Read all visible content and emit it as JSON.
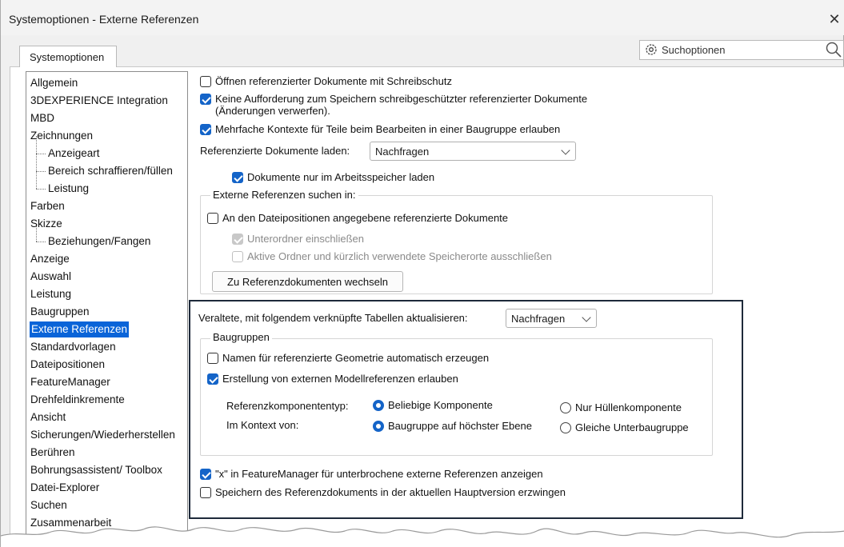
{
  "window": {
    "title": "Systemoptionen - Externe Referenzen",
    "close_symbol": "✕"
  },
  "search": {
    "label": "Suchoptionen",
    "gear_icon": "gear-icon",
    "search_icon": "search-icon"
  },
  "tabs": [
    {
      "label": "Systemoptionen",
      "active": true
    }
  ],
  "tree": {
    "items": [
      {
        "label": "Allgemein",
        "level": 0
      },
      {
        "label": "3DEXPERIENCE Integration",
        "level": 0
      },
      {
        "label": "MBD",
        "level": 0
      },
      {
        "label": "Zeichnungen",
        "level": 0
      },
      {
        "label": "Anzeigeart",
        "level": 1
      },
      {
        "label": "Bereich schraffieren/füllen",
        "level": 1
      },
      {
        "label": "Leistung",
        "level": 1
      },
      {
        "label": "Farben",
        "level": 0
      },
      {
        "label": "Skizze",
        "level": 0
      },
      {
        "label": "Beziehungen/Fangen",
        "level": 1
      },
      {
        "label": "Anzeige",
        "level": 0
      },
      {
        "label": "Auswahl",
        "level": 0
      },
      {
        "label": "Leistung",
        "level": 0
      },
      {
        "label": "Baugruppen",
        "level": 0
      },
      {
        "label": "Externe Referenzen",
        "level": 0,
        "selected": true
      },
      {
        "label": "Standardvorlagen",
        "level": 0
      },
      {
        "label": "Dateipositionen",
        "level": 0
      },
      {
        "label": "FeatureManager",
        "level": 0
      },
      {
        "label": "Drehfeldinkremente",
        "level": 0
      },
      {
        "label": "Ansicht",
        "level": 0
      },
      {
        "label": "Sicherungen/Wiederherstellen",
        "level": 0
      },
      {
        "label": "Berühren",
        "level": 0
      },
      {
        "label": "Bohrungsassistent/ Toolbox",
        "level": 0
      },
      {
        "label": "Datei-Explorer",
        "level": 0
      },
      {
        "label": "Suchen",
        "level": 0
      },
      {
        "label": "Zusammenarbeit",
        "level": 0
      }
    ]
  },
  "options": {
    "open_readonly": {
      "label": "Öffnen referenzierter Dokumente mit Schreibschutz",
      "checked": false
    },
    "no_prompt_line1": "Keine Aufforderung zum Speichern schreibgeschützter referenzierter Dokumente",
    "no_prompt_line2": "(Änderungen verwerfen).",
    "no_prompt_checked": true,
    "multiple_contexts": {
      "label": "Mehrfache Kontexte für Teile beim Bearbeiten in einer Baugruppe erlauben",
      "checked": true
    },
    "load_label": "Referenzierte Dokumente laden:",
    "load_value": "Nachfragen",
    "memory_only": {
      "label": "Dokumente nur im Arbeitsspeicher laden",
      "checked": true
    },
    "search_group_title": "Externe Referenzen suchen in:",
    "file_locations": {
      "label": "An den Dateipositionen angegebene referenzierte Dokumente",
      "checked": false
    },
    "include_subfolders": {
      "label": "Unterordner einschließen",
      "checked": true,
      "disabled": true
    },
    "exclude_recent": {
      "label": "Aktive Ordner und kürzlich verwendete Speicherorte ausschließen",
      "checked": false,
      "disabled": true
    },
    "goto_button": "Zu Referenzdokumenten wechseln",
    "update_tables_label": "Veraltete, mit folgendem verknüpfte Tabellen aktualisieren:",
    "update_tables_value": "Nachfragen",
    "assemblies_group_title": "Baugruppen",
    "auto_names": {
      "label": "Namen für referenzierte Geometrie automatisch erzeugen",
      "checked": false
    },
    "allow_model_refs": {
      "label": "Erstellung von externen Modellreferenzen erlauben",
      "checked": true
    },
    "ref_component_type_label": "Referenzkomponententyp:",
    "ref_any": {
      "label": "Beliebige Komponente",
      "selected": true
    },
    "ref_envelope": {
      "label": "Nur Hüllenkomponente",
      "selected": false
    },
    "context_label": "Im Kontext von:",
    "ctx_top": {
      "label": "Baugruppe auf höchster Ebene",
      "selected": true
    },
    "ctx_same": {
      "label": "Gleiche Unterbaugruppe",
      "selected": false
    },
    "show_x": {
      "label": "\"x\" in FeatureManager für unterbrochene externe Referenzen anzeigen",
      "checked": true
    },
    "force_save": {
      "label": "Speichern des Referenzdokuments in der aktuellen Hauptversion erzwingen",
      "checked": false
    }
  },
  "colors": {
    "accent": "#1464c8",
    "selection": "#0a64d8",
    "highlight_frame": "#1e2a3a"
  }
}
